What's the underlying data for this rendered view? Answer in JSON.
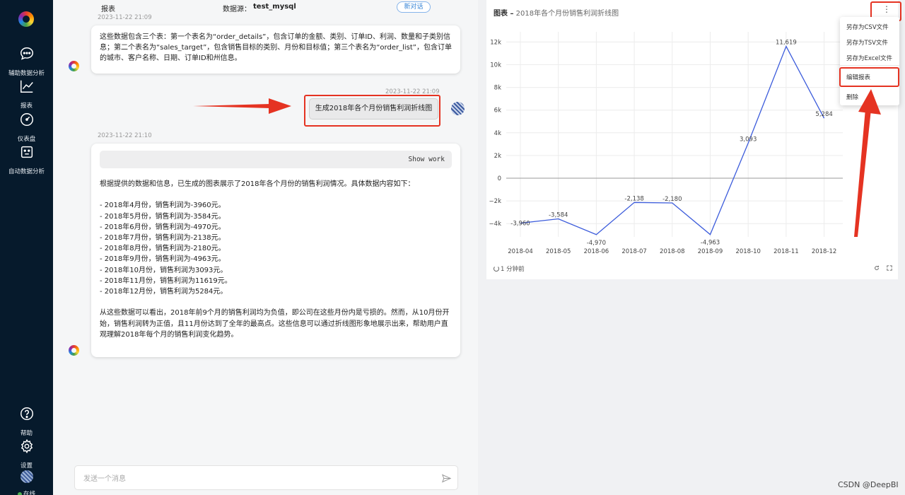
{
  "sidebar": {
    "items": [
      {
        "label": "辅助数据分析",
        "icon": "chat-bubble-icon"
      },
      {
        "label": "报表",
        "icon": "line-chart-icon"
      },
      {
        "label": "仪表盘",
        "icon": "gauge-icon"
      },
      {
        "label": "自动数据分析",
        "icon": "robot-icon"
      }
    ],
    "bottom": {
      "help": "帮助",
      "settings": "设置",
      "status": "在线"
    }
  },
  "chat": {
    "header": {
      "tab": "报表",
      "datasource_label": "数据源：",
      "datasource_value": "test_mysql",
      "new_chat": "新对话"
    },
    "msg1": {
      "timestamp": "2023-11-22 21:09",
      "lines": [
        "这些数据包含三个表：第一个表名为“order_details”，包含订单的金额、类别、订单ID、利润、数量和子类别信",
        "息；第二个表名为“sales_target”，包含销售目标的类别、月份和目标值；第三个表名为“order_list”，包含订单",
        "的城市、客户名称、日期、订单ID和州信息。"
      ]
    },
    "user_msg": {
      "timestamp": "2023-11-22 21:09",
      "text": "生成2018年各个月份销售利润折线图"
    },
    "msg2": {
      "timestamp": "2023-11-22 21:10",
      "show_work": "Show work",
      "intro": "根据提供的数据和信息，已生成的图表展示了2018年各个月份的销售利润情况。具体数据内容如下：",
      "items": [
        "- 2018年4月份，销售利润为-3960元。",
        "- 2018年5月份，销售利润为-3584元。",
        "- 2018年6月份，销售利润为-4970元。",
        "- 2018年7月份，销售利润为-2138元。",
        "- 2018年8月份，销售利润为-2180元。",
        "- 2018年9月份，销售利润为-4963元。",
        "- 2018年10月份，销售利润为3093元。",
        "- 2018年11月份，销售利润为11619元。",
        "- 2018年12月份，销售利润为5284元。"
      ],
      "conclusion": [
        "从这些数据可以看出，2018年前9个月的销售利润均为负值，即公司在这些月份内是亏损的。然而，从10月份开",
        "始，销售利润转为正值，且11月份达到了全年的最高点。这些信息可以通过折线图形象地展示出来，帮助用户直",
        "观理解2018年每个月的销售利润变化趋势。"
      ]
    },
    "input": {
      "placeholder": "发送一个消息"
    }
  },
  "chart_panel": {
    "title_prefix": "图表 –",
    "title": "2018年各个月份销售利润折线图",
    "refreshed": "1 分钟前",
    "menu": {
      "items": [
        "另存为CSV文件",
        "另存为TSV文件",
        "另存为Excel文件",
        "编辑报表",
        "删除"
      ]
    }
  },
  "chart_data": {
    "type": "line",
    "title": "2018年各个月份销售利润折线图",
    "categories": [
      "2018-04",
      "2018-05",
      "2018-06",
      "2018-07",
      "2018-08",
      "2018-09",
      "2018-10",
      "2018-11",
      "2018-12"
    ],
    "series": [
      {
        "values": [
          -3960,
          -3584,
          -4970,
          -2138,
          -2180,
          -4963,
          3093,
          11619,
          5284
        ],
        "color": "#3b5bdb"
      }
    ],
    "data_labels": [
      "-3,960",
      "-3,584",
      "-4,970",
      "-2,138",
      "-2,180",
      "-4,963",
      "3,093",
      "11,619",
      "5,284"
    ],
    "yticks": [
      -4000,
      -2000,
      0,
      2000,
      4000,
      6000,
      8000,
      10000,
      12000
    ],
    "ytick_labels": [
      "−4k",
      "−2k",
      "0",
      "2k",
      "4k",
      "6k",
      "8k",
      "10k",
      "12k"
    ],
    "ylim": [
      -5000,
      12500
    ],
    "grid": true,
    "legend": "none"
  },
  "watermark": "CSDN @DeepBI",
  "colors": {
    "sidebar_bg": "#061a2c",
    "accent": "#3a86d6",
    "annotation_red": "#e53322",
    "line": "#3b5bdb"
  }
}
